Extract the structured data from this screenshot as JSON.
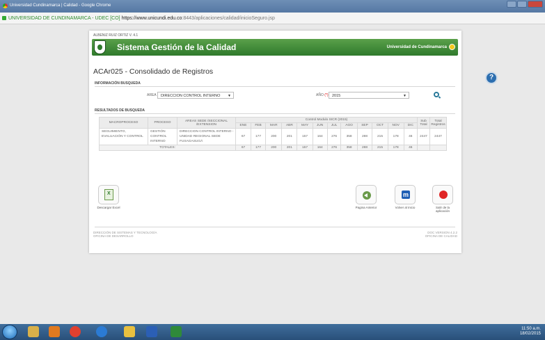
{
  "browser": {
    "window_title": "Universidad Cundinamarca | Calidad - Google Chrome",
    "site_label": "UNIVERSIDAD DE CUNDINAMARCA - UDEC [CO]",
    "url_scheme": "https://",
    "url_host": "www.unicundi.edu.co",
    "url_path": ":8443/aplicaciones/calidad/inicioSeguro.jsp"
  },
  "header": {
    "user": "ALBENIZ RUIZ ORTIZ V. 4.1",
    "system_title": "Sistema Gestión de la Calidad",
    "university": "Universidad de Cundinamarca"
  },
  "page_title": "ACAr025 - Consolidado de Registros",
  "search": {
    "section_label": "INFORMACIÓN BUSQUEDA",
    "area_label": "AREA",
    "area_value": "DIRECCION CONTROL INTERNO",
    "year_label": "AÑO",
    "year_value": "2015",
    "required_mark": "(*)"
  },
  "results": {
    "section_label": "RESULTADOS DE BUSQUEDA",
    "headers": {
      "macroproceso": "MACROPROCESO",
      "proceso": "PROCESO",
      "areas": "AREAS SEDE /SECCIONAL /EXTENSION",
      "group": "Control Modulo SICR (2015)",
      "subtotal": "Sub Total",
      "total": "Total Registros",
      "months": [
        "ENE",
        "FEB",
        "MAR",
        "ABR",
        "MAY",
        "JUN",
        "JUL",
        "AGO",
        "SEP",
        "OCT",
        "NOV",
        "DIC"
      ]
    },
    "rows": [
      {
        "macroproceso": "SEGUIMIENTO, EVALUACIÓN Y CONTROL",
        "proceso": "GESTIÓN CONTROL INTERNO",
        "area": "DIRECCION CONTROL INTERNO - UNIDAD REGIONAL SEDE FUSAGASUGÁ",
        "months": [
          "67",
          "177",
          "200",
          "201",
          "157",
          "164",
          "276",
          "358",
          "288",
          "215",
          "178",
          "46"
        ],
        "subtotal": "2447",
        "total": "2447"
      }
    ],
    "totals_label": "TOTALES:",
    "totals": [
      "67",
      "177",
      "200",
      "201",
      "157",
      "164",
      "276",
      "358",
      "288",
      "215",
      "178",
      "46"
    ]
  },
  "actions": {
    "download_excel": "Descargar Excel",
    "previous_page": "Pagina Anterior",
    "home": "Volver al inicio",
    "logout": "Salir de la aplicación"
  },
  "footer": {
    "left_line1": "DIRECCIÓN DE SISTEMAS Y TECNOLOGÍA",
    "left_line2": "OFICINA DE DESARROLLO",
    "right_line1": "DOC VERSION 4.2.2",
    "right_line2": "OFICINA DE CALIDAD"
  },
  "taskbar": {
    "time": "11:50 a.m.",
    "date": "18/02/2015"
  },
  "colors": {
    "banner_green": "#3f8a36",
    "accent_blue": "#2a7a9a"
  }
}
